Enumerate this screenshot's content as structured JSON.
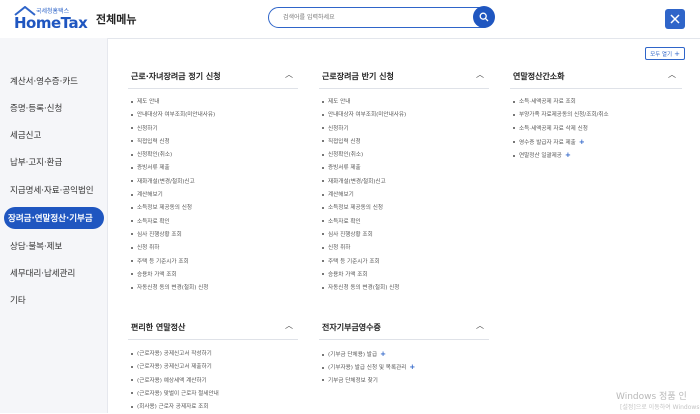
{
  "header": {
    "logo_small": "국세청홈택스",
    "logo_main": "HomeTax",
    "menu_title": "전체메뉴",
    "search_placeholder": "검색어를 입력하세요",
    "all_open_label": "모두 열기"
  },
  "sidebar": {
    "items": [
      "계산서·영수증·카드",
      "증명·등록·신청",
      "세금신고",
      "납부·고지·환급",
      "지급명세·자료·공익법인",
      "장려금·연말정산·기부금",
      "상담·불복·제보",
      "세무대리·납세관리",
      "기타"
    ],
    "active_index": 5
  },
  "sections": {
    "s1": {
      "title": "근로·자녀장려금 정기 신청",
      "items": [
        "제도 안내",
        "안내대상자 여부조회(미안내사유)",
        "신청하기",
        "직접입력 신청",
        "신청확인(취소)",
        "증빙서류 제출",
        "재화개설(변경/철회)신고",
        "계산해보기",
        "소득정보 제공동의 신청",
        "소득자료 확인",
        "심사 진행상황 조회",
        "신청 취하",
        "주택 등 기준시가 조회",
        "승용차 가액 조회",
        "자동신청 동의 변경(철회) 신청"
      ]
    },
    "s2": {
      "title": "근로장려금 반기 신청",
      "items": [
        "제도 안내",
        "안내대상자 여부조회(미안내사유)",
        "신청하기",
        "직접입력 신청",
        "신청확인(취소)",
        "증빙서류 제출",
        "재화개설(변경/철회)신고",
        "계산해보기",
        "소득정보 제공동의 신청",
        "소득자료 확인",
        "심사 진행상황 조회",
        "신청 취하",
        "주택 등 기준시가 조회",
        "승용차 가액 조회",
        "자동신청 동의 변경(철회) 신청"
      ]
    },
    "s3": {
      "title": "연말정산간소화",
      "items": [
        "소득·세액공제 자료 조회",
        "부양가족 자료제공동의 신청/조회/취소",
        "소득·세액공제 자료 삭제 신청",
        "영수증 발급자 자료 제출",
        "연말정산 일괄제공"
      ],
      "plus": [
        false,
        false,
        false,
        true,
        true
      ]
    },
    "s4": {
      "title": "편리한 연말정산",
      "items": [
        "(근로자용) 공제신고서 작성하기",
        "(근로자용) 공제신고서 제출하기",
        "(근로자용) 예상세액 계산하기",
        "(근로자용) 맞벌이 근로자 절세안내",
        "(회사용) 근로자 공제자료 조회"
      ]
    },
    "s5": {
      "title": "전자기부금영수증",
      "items": [
        "(기부금 단체용) 발급",
        "(기부자용) 발급 신청 및 목록관리",
        "기부금 단체정보 찾기"
      ],
      "plus": [
        true,
        true,
        false
      ]
    }
  },
  "watermark": {
    "line1": "Windows 정품 인",
    "line2": "[설정]으로 이동하여 Windows를 정품"
  },
  "colors": {
    "accent": "#1f56c0",
    "border": "#2f65c9"
  }
}
